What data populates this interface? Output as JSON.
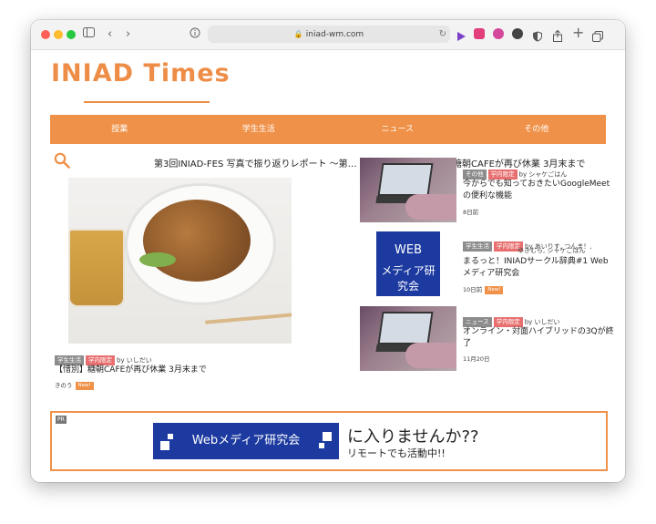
{
  "browser": {
    "url": "iniad-wm.com"
  },
  "site": {
    "logo": "INIAD Times"
  },
  "nav": {
    "items": [
      "授業",
      "学生生活",
      "ニュース",
      "その他"
    ]
  },
  "ticker": {
    "items": [
      "第3回INIAD-FES 写真で振り返りレポート 〜第…",
      "【惜別】糖朝CAFEが再び休業 3月末まで"
    ]
  },
  "featured": {
    "tags": [
      "学生生活",
      "学内限定"
    ],
    "author": "by いしだい",
    "title": "【惜別】糖朝CAFEが再び休業 3月末まで",
    "date": "きのう",
    "new_badge": "New!"
  },
  "articles": [
    {
      "tags": [
        "その他",
        "学内限定"
      ],
      "author": "by シャケごはん",
      "title_line1": "今からでも知っておきたいGoogleMeet",
      "title_line2": "の便利な機能",
      "date": "8日前"
    },
    {
      "tags": [
        "学生生活",
        "学内限定"
      ],
      "author_line1": "by あいりす, つんま！,",
      "author_line2": "ゆきむら, シャケごはん",
      "title_line1": "まるっと！INIADサークル辞典#1 Web",
      "title_line2": "メディア研究会",
      "date": "10日前",
      "new_badge": "New!",
      "thumb_line1": "WEB",
      "thumb_line2": "メディア研究会"
    },
    {
      "tags": [
        "ニュース",
        "学内限定"
      ],
      "author": "by いしだい",
      "title_line1": "オンライン・対面ハイブリッドの3Qが終",
      "title_line2": "了",
      "date": "11月20日"
    }
  ],
  "pr": {
    "label": "PR",
    "blue_text": "Webメディア研究会",
    "line1": "に入りませんか??",
    "line2": "リモートでも活動中!!"
  }
}
